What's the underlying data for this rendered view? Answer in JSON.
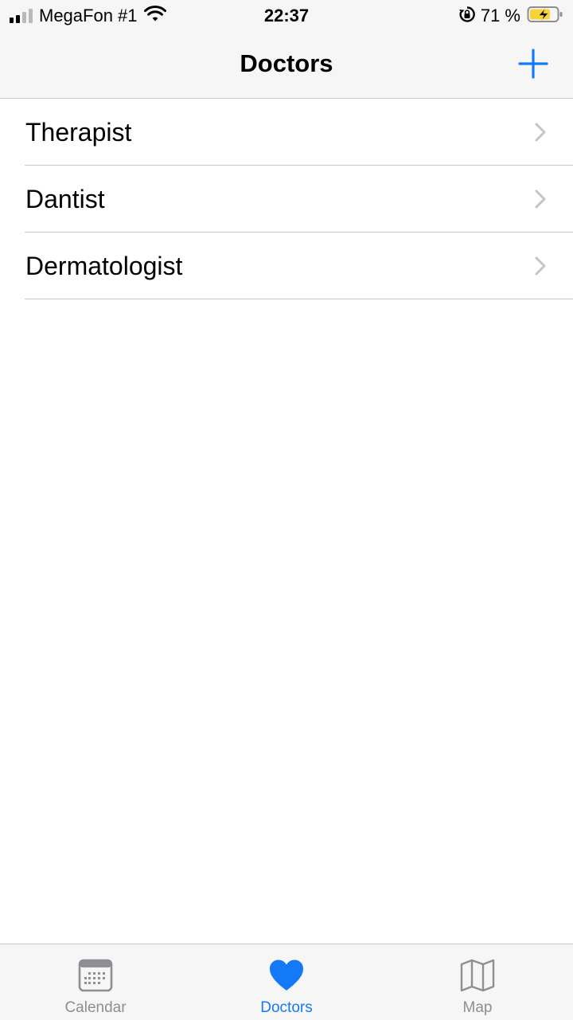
{
  "status_bar": {
    "carrier": "MegaFon #1",
    "time": "22:37",
    "battery_percent": "71 %",
    "signal_bars_active": 2,
    "signal_bars_total": 4
  },
  "nav": {
    "title": "Doctors",
    "add_icon": "plus-icon"
  },
  "doctors": {
    "items": [
      {
        "label": "Therapist"
      },
      {
        "label": "Dantist"
      },
      {
        "label": "Dermatologist"
      }
    ]
  },
  "tab_bar": {
    "tabs": [
      {
        "label": "Calendar",
        "icon": "calendar-icon",
        "selected": false
      },
      {
        "label": "Doctors",
        "icon": "heart-icon",
        "selected": true
      },
      {
        "label": "Map",
        "icon": "map-icon",
        "selected": false
      }
    ]
  },
  "colors": {
    "accent": "#1479f6",
    "inactive": "#8e8e93",
    "chevron": "#c4c4c7",
    "battery_fill": "#f6d23b"
  }
}
